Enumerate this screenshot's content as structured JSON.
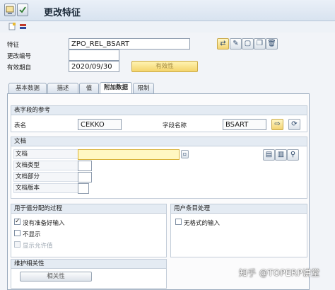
{
  "window": {
    "title": "更改特征"
  },
  "header": {
    "char_label": "特征",
    "char_value": "ZPO_REL_BSART",
    "change_no_label": "更改编号",
    "change_no_value": "",
    "valid_from_label": "有效期自",
    "valid_from_value": "2020/09/30",
    "validity_button": "有效性"
  },
  "tabs": [
    {
      "label": "基本数据"
    },
    {
      "label": "描述"
    },
    {
      "label": "值"
    },
    {
      "label": "附加数据"
    },
    {
      "label": "限制"
    }
  ],
  "active_tab": "附加数据",
  "table_ref": {
    "title": "表字段的参考",
    "table_label": "表名",
    "table_value": "CEKKO",
    "field_label": "字段名称",
    "field_value": "BSART"
  },
  "document": {
    "title": "文档",
    "doc_label": "文档",
    "doc_value": "",
    "type_label": "文档类型",
    "part_label": "文档部分",
    "version_label": "文档版本"
  },
  "value_assign": {
    "title": "用于值分配的过程",
    "opt1": "没有准备好输入",
    "opt1_checked": true,
    "opt2": "不显示",
    "opt2_checked": false,
    "opt3": "显示允许值",
    "opt3_checked": false
  },
  "user_entry": {
    "title": "用户条目处理",
    "opt1": "无格式的输入",
    "opt1_checked": false
  },
  "maint_deps": {
    "title": "维护相关性",
    "button": "相关性"
  },
  "watermark": "知乎 @TOPERP讲堂",
  "icons": {
    "title_icon_1": "display-change-icon",
    "title_icon_2": "checkmark-icon",
    "toolbar_1": "new-icon",
    "toolbar_2": "transport-icon"
  }
}
